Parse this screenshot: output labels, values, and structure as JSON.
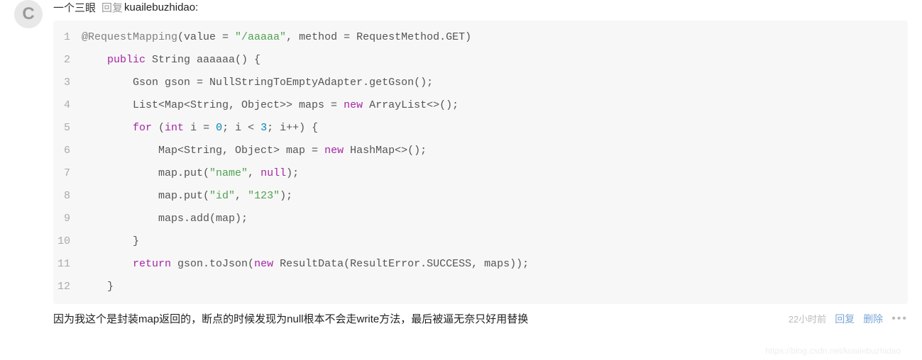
{
  "comment": {
    "avatar_letter": "C",
    "username": "一个三眼",
    "reply_label": "回复",
    "reply_target": "kuailebuzhidao:",
    "body_text": "因为我这个是封装map返回的，断点的时候发现为null根本不会走write方法，最后被逼无奈只好用替换",
    "timestamp": "22小时前",
    "reply_action": "回复",
    "delete_action": "删除"
  },
  "code": {
    "lines": [
      {
        "n": "1",
        "tokens": [
          [
            "annotation",
            "@RequestMapping"
          ],
          [
            "plain",
            "(value = "
          ],
          [
            "string",
            "\"/aaaaa\""
          ],
          [
            "plain",
            ", method = RequestMethod.GET)"
          ]
        ]
      },
      {
        "n": "2",
        "tokens": [
          [
            "plain",
            "    "
          ],
          [
            "keyword",
            "public"
          ],
          [
            "plain",
            " String aaaaaa() {"
          ]
        ]
      },
      {
        "n": "3",
        "tokens": [
          [
            "plain",
            "        Gson gson = NullStringToEmptyAdapter.getGson();"
          ]
        ]
      },
      {
        "n": "4",
        "tokens": [
          [
            "plain",
            "        List<Map<String, Object>> maps = "
          ],
          [
            "new",
            "new"
          ],
          [
            "plain",
            " ArrayList<>();"
          ]
        ]
      },
      {
        "n": "5",
        "tokens": [
          [
            "plain",
            "        "
          ],
          [
            "keyword",
            "for"
          ],
          [
            "plain",
            " ("
          ],
          [
            "keyword",
            "int"
          ],
          [
            "plain",
            " i = "
          ],
          [
            "number",
            "0"
          ],
          [
            "plain",
            "; i < "
          ],
          [
            "number",
            "3"
          ],
          [
            "plain",
            "; i++) {"
          ]
        ]
      },
      {
        "n": "6",
        "tokens": [
          [
            "plain",
            "            Map<String, Object> map = "
          ],
          [
            "new",
            "new"
          ],
          [
            "plain",
            " HashMap<>();"
          ]
        ]
      },
      {
        "n": "7",
        "tokens": [
          [
            "plain",
            "            map.put("
          ],
          [
            "string",
            "\"name\""
          ],
          [
            "plain",
            ", "
          ],
          [
            "null",
            "null"
          ],
          [
            "plain",
            ");"
          ]
        ]
      },
      {
        "n": "8",
        "tokens": [
          [
            "plain",
            "            map.put("
          ],
          [
            "string",
            "\"id\""
          ],
          [
            "plain",
            ", "
          ],
          [
            "string",
            "\"123\""
          ],
          [
            "plain",
            ");"
          ]
        ]
      },
      {
        "n": "9",
        "tokens": [
          [
            "plain",
            "            maps.add(map);"
          ]
        ]
      },
      {
        "n": "10",
        "tokens": [
          [
            "plain",
            "        }"
          ]
        ]
      },
      {
        "n": "11",
        "tokens": [
          [
            "plain",
            "        "
          ],
          [
            "keyword",
            "return"
          ],
          [
            "plain",
            " gson.toJson("
          ],
          [
            "new",
            "new"
          ],
          [
            "plain",
            " ResultData(ResultError.SUCCESS, maps));"
          ]
        ]
      },
      {
        "n": "12",
        "tokens": [
          [
            "plain",
            "    }"
          ]
        ]
      }
    ]
  },
  "watermark": "https://blog.csdn.net/kuailebuzhidao"
}
